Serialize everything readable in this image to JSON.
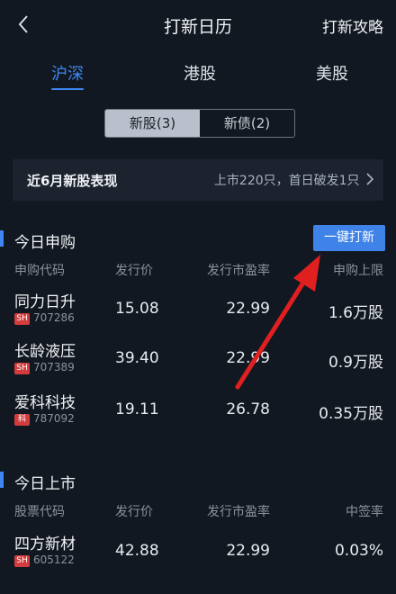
{
  "header": {
    "title": "打新日历",
    "strategy_link": "打新攻略"
  },
  "market_tabs": [
    {
      "label": "沪深",
      "active": true
    },
    {
      "label": "港股",
      "active": false
    },
    {
      "label": "美股",
      "active": false
    }
  ],
  "segments": [
    {
      "label": "新股(3)",
      "active": true
    },
    {
      "label": "新债(2)",
      "active": false
    }
  ],
  "performance": {
    "label": "近6月新股表现",
    "summary": "上市220只，首日破发1只"
  },
  "subscribe_today": {
    "title": "今日申购",
    "one_key_button": "一键打新",
    "columns": [
      "申购代码",
      "发行价",
      "发行市盈率",
      "申购上限"
    ],
    "rows": [
      {
        "name": "同力日升",
        "market": "SH",
        "code": "707286",
        "price": "15.08",
        "pe": "22.99",
        "limit": "1.6万股"
      },
      {
        "name": "长龄液压",
        "market": "SH",
        "code": "707389",
        "price": "39.40",
        "pe": "22.99",
        "limit": "0.9万股"
      },
      {
        "name": "爱科科技",
        "market": "科",
        "code": "787092",
        "price": "19.11",
        "pe": "26.78",
        "limit": "0.35万股"
      }
    ]
  },
  "listing_today": {
    "title": "今日上市",
    "columns": [
      "股票代码",
      "发行价",
      "发行市盈率",
      "中签率"
    ],
    "rows": [
      {
        "name": "四方新材",
        "market": "SH",
        "code": "605122",
        "price": "42.88",
        "pe": "22.99",
        "rate": "0.03%"
      }
    ]
  },
  "colors": {
    "accent": "#3e87f0",
    "background": "#121821",
    "annotation_arrow": "#e02020"
  }
}
